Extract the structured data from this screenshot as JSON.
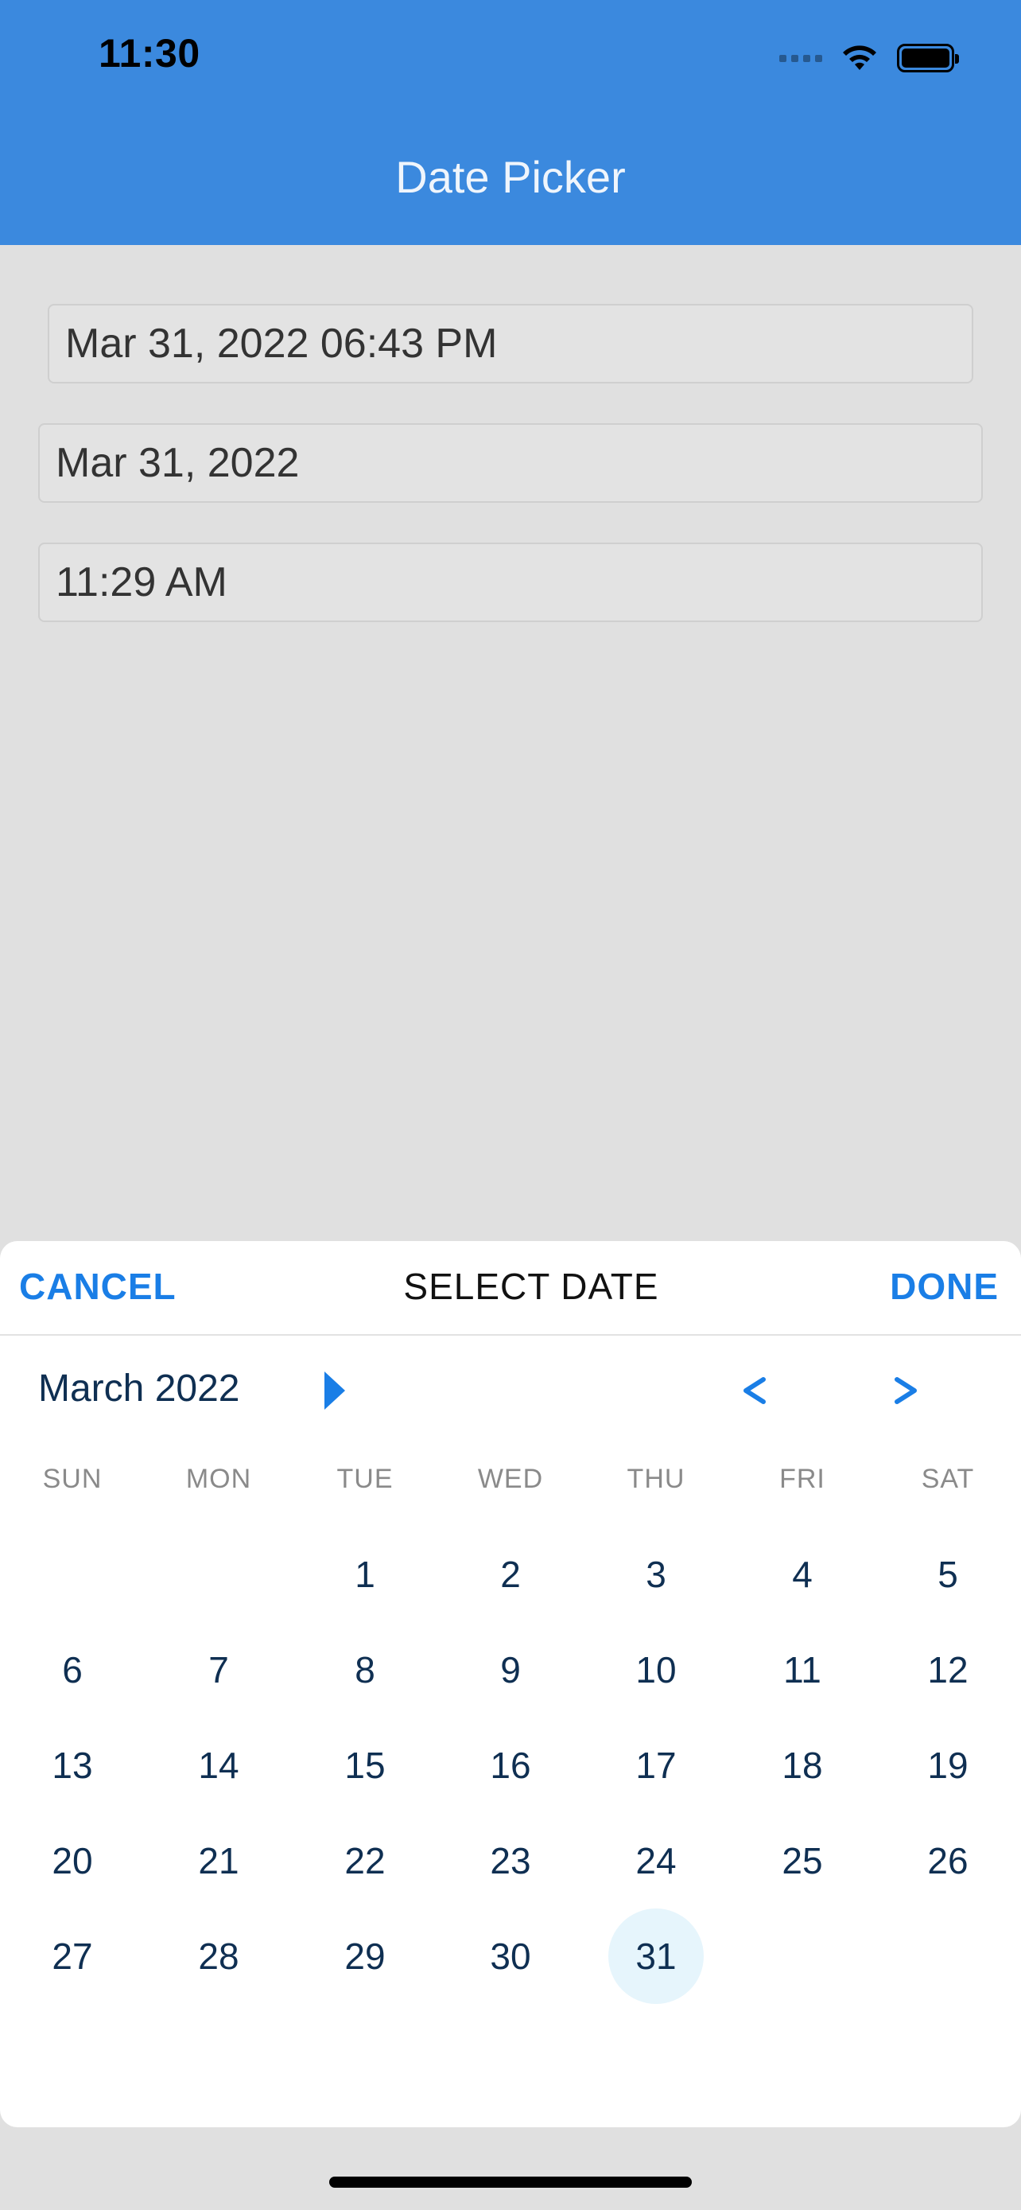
{
  "status_bar": {
    "time": "11:30"
  },
  "header": {
    "title": "Date Picker",
    "background_color": "#3b89de"
  },
  "fields": [
    {
      "value": "Mar 31, 2022 06:43 PM"
    },
    {
      "value": "Mar 31, 2022"
    },
    {
      "value": "11:29 AM"
    }
  ],
  "picker": {
    "cancel_label": "CANCEL",
    "title": "SELECT DATE",
    "done_label": "DONE",
    "accent_color": "#1a7ee6",
    "month_label": "March 2022",
    "month_toggle_icon": "triangle-right-icon",
    "prev_icon": "chevron-left-icon",
    "next_icon": "chevron-right-icon",
    "weekdays": [
      "SUN",
      "MON",
      "TUE",
      "WED",
      "THU",
      "FRI",
      "SAT"
    ],
    "first_weekday_index": 2,
    "days_in_month": 31,
    "selected_day": "31"
  }
}
